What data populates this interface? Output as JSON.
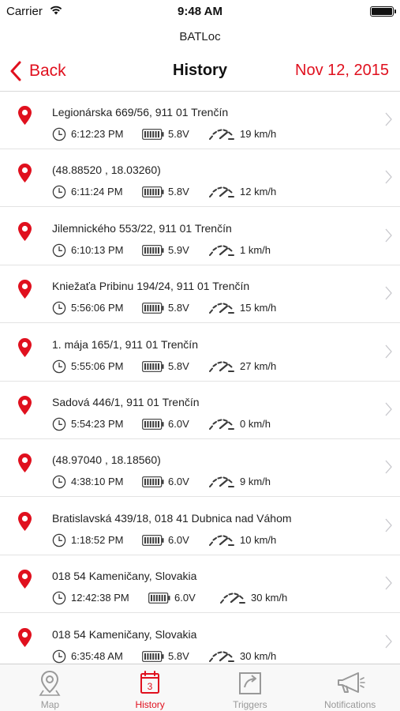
{
  "status_bar": {
    "carrier": "Carrier",
    "time": "9:48 AM",
    "wifi_icon": "wifi-icon",
    "battery_icon": "battery-icon"
  },
  "app": {
    "title": "BATLoc"
  },
  "nav": {
    "back_label": "Back",
    "title": "History",
    "date": "Nov 12, 2015"
  },
  "colors": {
    "accent": "#e0101e",
    "text": "#222222",
    "icon_gray": "#3a3a3a",
    "tab_inactive": "#999999",
    "separator": "#e3e3e3"
  },
  "history": [
    {
      "address": "Legionárska 669/56, 911 01 Trenčín",
      "time": "6:12:23 PM",
      "voltage": "5.8V",
      "speed": "19 km/h"
    },
    {
      "address": "(48.88520 , 18.03260)",
      "time": "6:11:24 PM",
      "voltage": "5.8V",
      "speed": "12 km/h"
    },
    {
      "address": "Jilemnického 553/22, 911 01 Trenčín",
      "time": "6:10:13 PM",
      "voltage": "5.9V",
      "speed": "1 km/h"
    },
    {
      "address": "Kniežaťa Pribinu 194/24, 911 01 Trenčín",
      "time": "5:56:06 PM",
      "voltage": "5.8V",
      "speed": "15 km/h"
    },
    {
      "address": "1. mája 165/1, 911 01 Trenčín",
      "time": "5:55:06 PM",
      "voltage": "5.8V",
      "speed": "27 km/h"
    },
    {
      "address": "Sadová 446/1, 911 01 Trenčín",
      "time": "5:54:23 PM",
      "voltage": "6.0V",
      "speed": "0 km/h"
    },
    {
      "address": "(48.97040 , 18.18560)",
      "time": "4:38:10 PM",
      "voltage": "6.0V",
      "speed": "9 km/h"
    },
    {
      "address": "Bratislavská 439/18, 018 41 Dubnica nad Váhom",
      "time": "1:18:52 PM",
      "voltage": "6.0V",
      "speed": "10 km/h"
    },
    {
      "address": "018 54 Kameničany, Slovakia",
      "time": "12:42:38 PM",
      "voltage": "6.0V",
      "speed": "30 km/h"
    },
    {
      "address": "018 54 Kameničany, Slovakia",
      "time": "6:35:48 AM",
      "voltage": "5.8V",
      "speed": "30 km/h"
    }
  ],
  "row_icons": {
    "pin": "map-pin-icon",
    "clock": "clock-icon",
    "battery": "battery-icon",
    "speed": "speedometer-icon",
    "chevron": "chevron-right-icon"
  },
  "tabs": [
    {
      "label": "Map",
      "icon": "map-pin-icon",
      "active": false
    },
    {
      "label": "History",
      "icon": "calendar-icon",
      "badge": "3",
      "active": true
    },
    {
      "label": "Triggers",
      "icon": "trigger-icon",
      "active": false
    },
    {
      "label": "Notifications",
      "icon": "megaphone-icon",
      "active": false
    }
  ]
}
